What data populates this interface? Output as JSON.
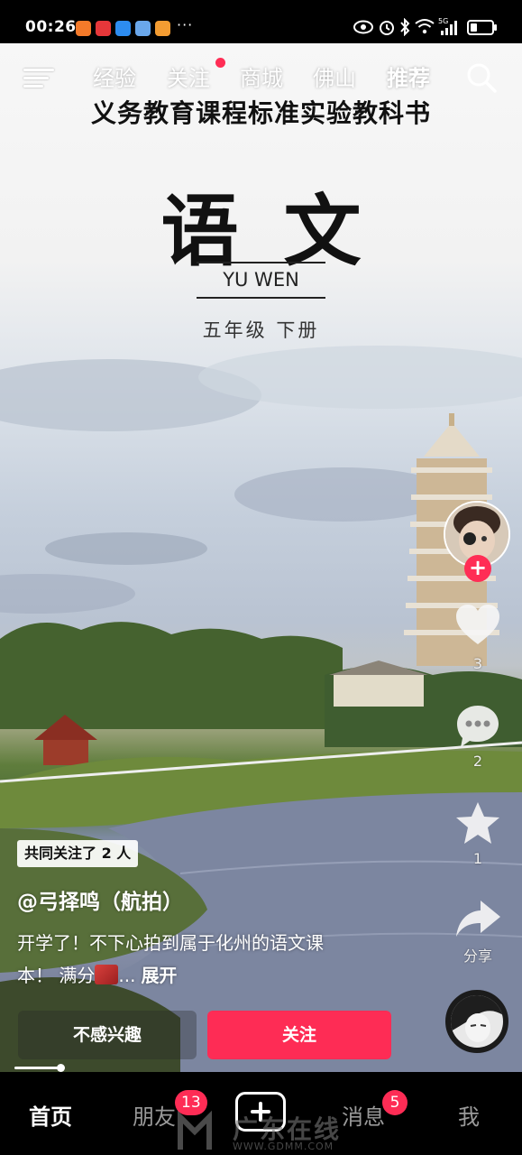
{
  "status_bar": {
    "time": "00:26",
    "more": "···",
    "network": "5G"
  },
  "top_nav": {
    "tabs": [
      "经验",
      "关注",
      "商城",
      "佛山",
      "推荐"
    ],
    "active_tab": "推荐",
    "menu_icon": "menu-icon",
    "search_icon": "search-icon",
    "accent_color": "#ff2d55"
  },
  "book_cover": {
    "series": "义务教育课程标准实验教科书",
    "subject": "语文",
    "pinyin": "YU WEN",
    "grade": "五年级 下册"
  },
  "rail": {
    "like_count": "3",
    "comment_count": "2",
    "favorite_count": "1",
    "share_label": "分享"
  },
  "post": {
    "mutual_follow": "共同关注了 2 人",
    "author": "@弓择鸣（航拍）",
    "caption_line1": "开学了！不下心拍到属于化州的语文课",
    "caption_line2": "本！ 满分",
    "caption_ellipsis": "...",
    "expand_label": "展开"
  },
  "actions": {
    "dislike_label": "不感兴趣",
    "follow_label": "关注",
    "follow_color": "#fe2c55"
  },
  "playback_progress": 0.1,
  "bottom_nav": {
    "home": "首页",
    "friends": "朋友",
    "friends_badge": "13",
    "messages": "消息",
    "messages_badge": "5",
    "me": "我"
  },
  "watermark": {
    "text": "广东在线",
    "url": "WWW.GDMM.COM"
  }
}
